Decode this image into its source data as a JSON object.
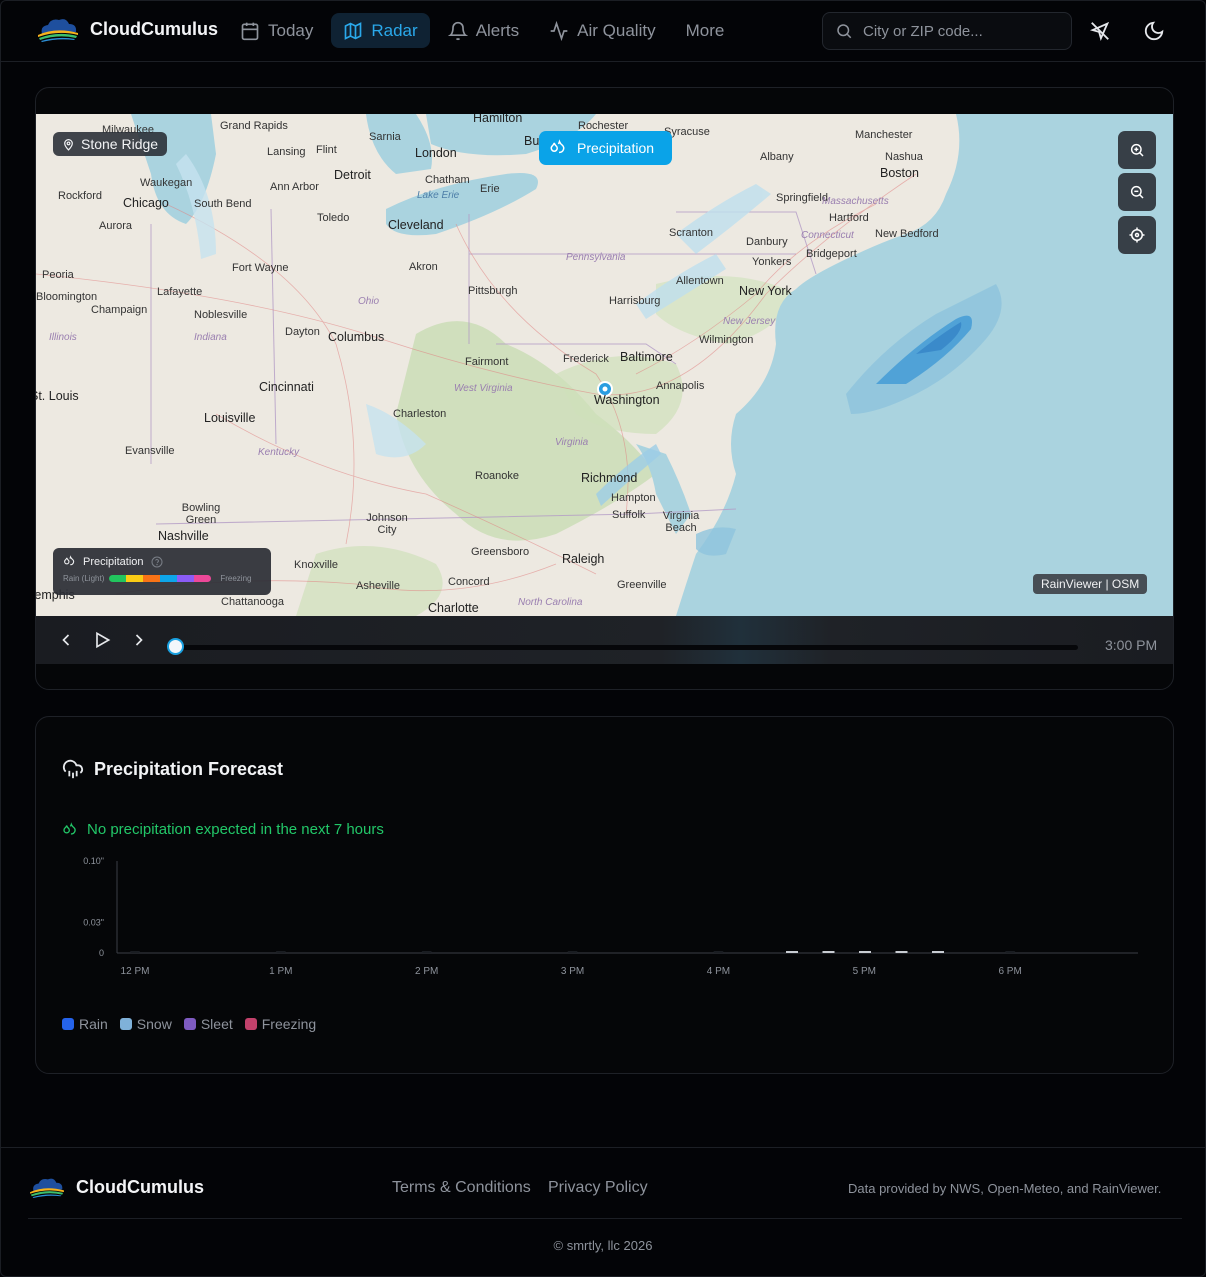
{
  "header": {
    "brand": "CloudCumulus",
    "nav": [
      {
        "label": "Today",
        "icon": "calendar-icon"
      },
      {
        "label": "Radar",
        "icon": "map-icon",
        "active": true
      },
      {
        "label": "Alerts",
        "icon": "bell-icon"
      },
      {
        "label": "Air Quality",
        "icon": "activity-icon"
      },
      {
        "label": "More"
      }
    ],
    "search_placeholder": "City or ZIP code...",
    "icons": [
      "location-off-icon",
      "moon-icon"
    ]
  },
  "radar": {
    "location": "Stone Ridge",
    "layer_button": "Precipitation",
    "zoom_controls": [
      "zoom-in-icon",
      "zoom-out-icon",
      "locate-icon"
    ],
    "legend": {
      "title": "Precipitation",
      "low_label": "Rain (Light)",
      "high_label": "Freezing",
      "scale_colors": [
        "#22c55e",
        "#facc15",
        "#f97316",
        "#0ea5e9",
        "#8b5cf6",
        "#ec4899"
      ]
    },
    "attribution": "RainViewer | OSM",
    "time": "3:00 PM",
    "map_labels": {
      "cities": [
        "Hamilton",
        "Rochester",
        "Manchester",
        "Grand Rapids",
        "Sarnia",
        "Flint",
        "London",
        "Buffalo",
        "Syracuse",
        "Albany",
        "Nashua",
        "Milwaukee",
        "Lansing",
        "Detroit",
        "Chatham",
        "Boston",
        "Waukegan",
        "Ann Arbor",
        "Erie",
        "Springfield",
        "Rockford",
        "Chicago",
        "South Bend",
        "Toledo",
        "Cleveland",
        "Hartford",
        "Aurora",
        "Scranton",
        "Danbury",
        "New Bedford",
        "Peoria",
        "Fort Wayne",
        "Akron",
        "Bridgeport",
        "Yonkers",
        "Lafayette",
        "Pittsburgh",
        "Allentown",
        "New York",
        "Bloomington",
        "Champaign",
        "Noblesville",
        "Harrisburg",
        "Dayton",
        "Columbus",
        "Wilmington",
        "Fairmont",
        "Frederick",
        "Baltimore",
        "Cincinnati",
        "Annapolis",
        "St. Louis",
        "Washington",
        "Louisville",
        "Charleston",
        "Evansville",
        "Roanoke",
        "Richmond",
        "Hampton",
        "Bowling Green",
        "Johnson City",
        "Suffolk",
        "Virginia Beach",
        "Nashville",
        "Greensboro",
        "Raleigh",
        "Knoxville",
        "Concord",
        "Greenville",
        "Memphis",
        "Asheville",
        "Chattanooga",
        "Charlotte"
      ],
      "states": [
        "Massachusetts",
        "Connecticut",
        "Pennsylvania",
        "Ohio",
        "Indiana",
        "Illinois",
        "New Jersey",
        "West Virginia",
        "Kentucky",
        "Virginia",
        "North Carolina"
      ],
      "water": [
        "Lake Erie"
      ]
    }
  },
  "forecast": {
    "title": "Precipitation Forecast",
    "status": "No precipitation expected in the next 7 hours",
    "legend": [
      {
        "label": "Rain",
        "color": "#2563eb"
      },
      {
        "label": "Snow",
        "color": "#7fb1d9"
      },
      {
        "label": "Sleet",
        "color": "#7e5bc1"
      },
      {
        "label": "Freezing",
        "color": "#c2416b"
      }
    ],
    "chart_data": {
      "type": "bar",
      "title": "",
      "xlabel": "",
      "ylabel": "",
      "y_ticks": [
        "0",
        "0.03\"",
        "0.10\""
      ],
      "x_ticks": [
        "12 PM",
        "1 PM",
        "2 PM",
        "3 PM",
        "4 PM",
        "5 PM",
        "6 PM"
      ],
      "series": [
        {
          "name": "Rain",
          "values": [
            0,
            0,
            0,
            0,
            0,
            0,
            0
          ]
        },
        {
          "name": "Snow",
          "values": [
            0,
            0,
            0,
            0,
            0,
            0,
            0
          ]
        },
        {
          "name": "Sleet",
          "values": [
            0,
            0,
            0,
            0,
            0,
            0,
            0
          ]
        },
        {
          "name": "Freezing",
          "values": [
            0,
            0,
            0,
            0,
            0,
            0,
            0
          ]
        }
      ],
      "ylim": [
        0,
        0.1
      ]
    }
  },
  "footer": {
    "brand": "CloudCumulus",
    "links": [
      "Terms & Conditions",
      "Privacy Policy"
    ],
    "credit": "Data provided by NWS, Open-Meteo, and RainViewer.",
    "copyright": "© smrtly, llc 2026"
  }
}
